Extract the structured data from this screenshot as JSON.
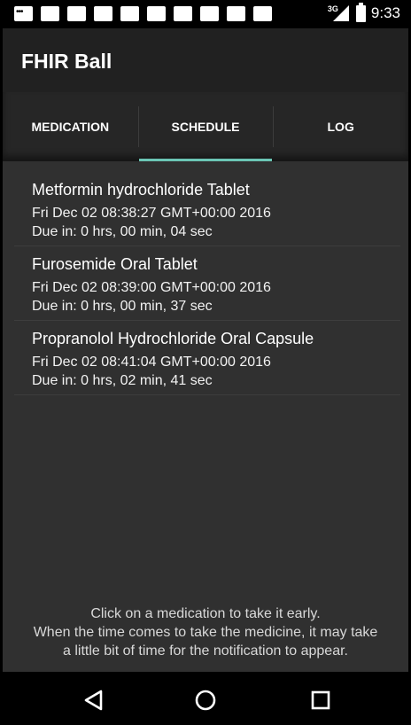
{
  "status_bar": {
    "network": "3G",
    "time": "9:33"
  },
  "app": {
    "title": "FHIR Ball"
  },
  "tabs": [
    {
      "label": "MEDICATION",
      "active": false
    },
    {
      "label": "SCHEDULE",
      "active": true
    },
    {
      "label": "LOG",
      "active": false
    }
  ],
  "schedule": [
    {
      "name": "Metformin hydrochloride Tablet",
      "time": "Fri Dec 02 08:38:27 GMT+00:00 2016",
      "due": "Due in: 0 hrs, 00 min, 04 sec"
    },
    {
      "name": "Furosemide Oral Tablet",
      "time": "Fri Dec 02 08:39:00 GMT+00:00 2016",
      "due": "Due in: 0 hrs, 00 min, 37 sec"
    },
    {
      "name": "Propranolol Hydrochloride Oral Capsule",
      "time": "Fri Dec 02 08:41:04 GMT+00:00 2016",
      "due": "Due in: 0 hrs, 02 min, 41 sec"
    }
  ],
  "hint": {
    "line1": "Click on a medication to take it early.",
    "line2": "When the time comes to take the medicine, it may take",
    "line3": "a little bit of time for the notification to appear."
  },
  "colors": {
    "accent": "#6bc5b5",
    "app_bar": "#212121",
    "background": "#303030"
  }
}
